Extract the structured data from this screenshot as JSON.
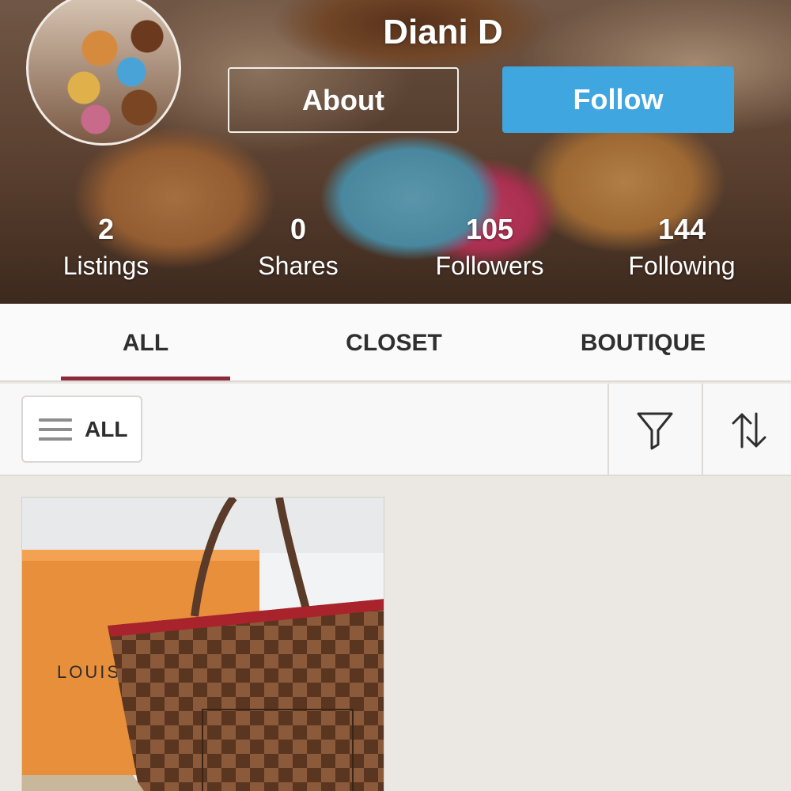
{
  "profile": {
    "username": "Diani D",
    "about_label": "About",
    "follow_label": "Follow"
  },
  "stats": [
    {
      "value": "2",
      "label": "Listings"
    },
    {
      "value": "0",
      "label": "Shares"
    },
    {
      "value": "105",
      "label": "Followers"
    },
    {
      "value": "144",
      "label": "Following"
    }
  ],
  "tabs": [
    {
      "label": "ALL",
      "active": true
    },
    {
      "label": "CLOSET",
      "active": false
    },
    {
      "label": "BOUTIQUE",
      "active": false
    }
  ],
  "filterbar": {
    "dropdown_label": "ALL",
    "icons": [
      "menu-icon",
      "filter-icon",
      "sort-icon"
    ]
  },
  "listings": [
    {
      "image_text": "LOUIS"
    }
  ],
  "colors": {
    "follow_button": "#3fa6e0",
    "active_tab_underline": "#8c2a3b",
    "page_background": "#ebe7e2"
  }
}
